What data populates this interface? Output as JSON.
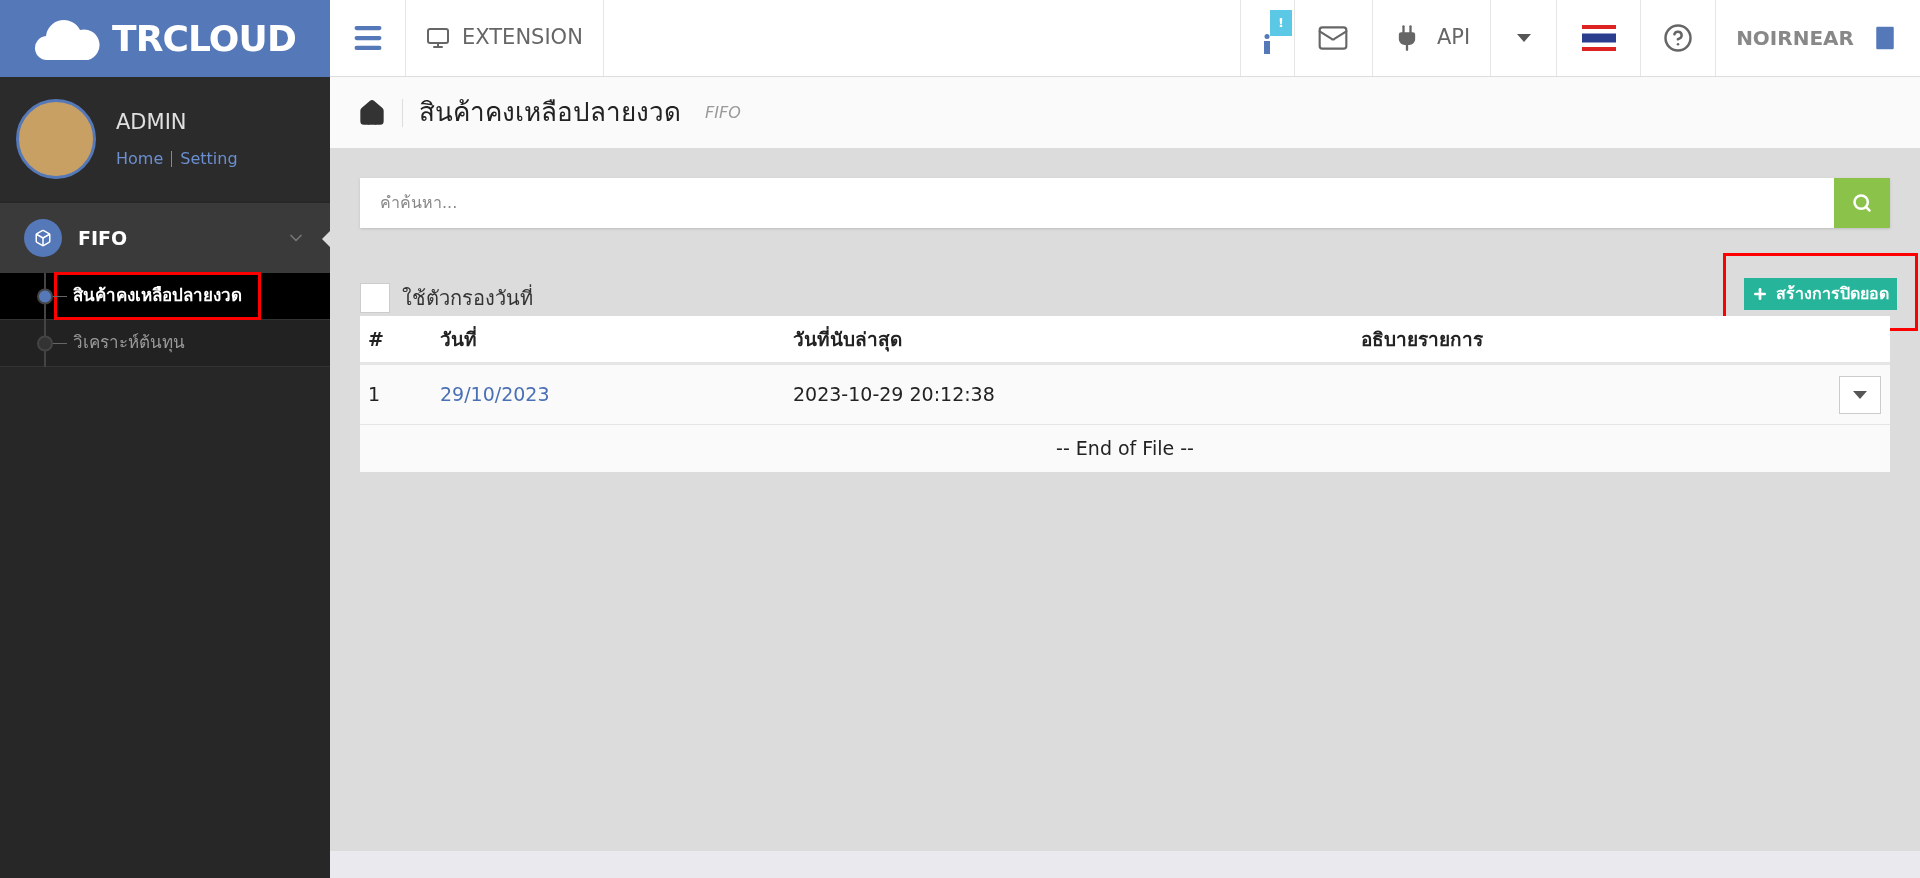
{
  "header": {
    "logo": "TRCLOUD",
    "menu_item": "EXTENSION",
    "notification_badge": "!",
    "api": "API",
    "user": "NOIRNEAR"
  },
  "profile": {
    "name": "ADMIN",
    "links": [
      "Home",
      "Setting"
    ]
  },
  "sidebar": {
    "group": {
      "label": "FIFO",
      "expanded": true,
      "children": [
        {
          "label": "สินค้าคงเหลือปลายงวด",
          "selected": true,
          "annotated": true
        },
        {
          "label": "วิเคราะห์ต้นทุน",
          "selected": false,
          "annotated": false
        }
      ]
    }
  },
  "page": {
    "title": "สินค้าคงเหลือปลายงวด",
    "subtitle": "FIFO"
  },
  "search": {
    "placeholder": "คำค้นหา..."
  },
  "date_filter": {
    "label": "ใช้ตัวกรองวันที่",
    "checked": false
  },
  "create_button": {
    "label": "สร้างการปิดยอด",
    "annotated": true
  },
  "table": {
    "columns": [
      "#",
      "วันที่",
      "วันที่นับล่าสุด",
      "อธิบายรายการ"
    ],
    "rows": [
      {
        "number": "1",
        "date": "29/10/2023",
        "counted_at": "2023-10-29 20:12:38"
      }
    ],
    "footer": "-- End of File --"
  }
}
